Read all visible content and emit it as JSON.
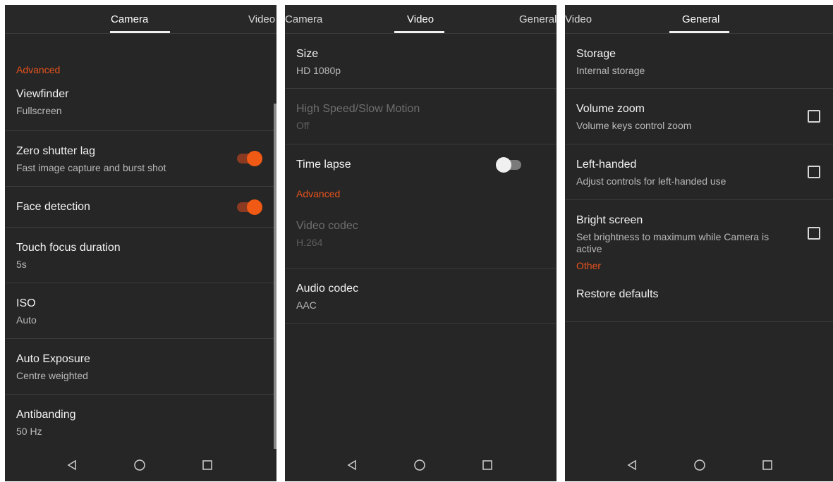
{
  "panels": {
    "camera": {
      "tabs": {
        "active": "Camera",
        "right": "Video"
      },
      "section_advanced": "Advanced",
      "items": [
        {
          "title": "Viewfinder",
          "subtitle": "Fullscreen"
        },
        {
          "title": "Zero shutter lag",
          "subtitle": "Fast image capture and burst shot",
          "toggle": "on"
        },
        {
          "title": "Face detection",
          "toggle": "on"
        },
        {
          "title": "Touch focus duration",
          "subtitle": "5s"
        },
        {
          "title": "ISO",
          "subtitle": "Auto"
        },
        {
          "title": "Auto Exposure",
          "subtitle": "Centre weighted"
        },
        {
          "title": "Antibanding",
          "subtitle": "50 Hz"
        }
      ]
    },
    "video": {
      "tabs": {
        "left": "Camera",
        "active": "Video",
        "right": "General"
      },
      "section_advanced": "Advanced",
      "items": [
        {
          "title": "Size",
          "subtitle": "HD 1080p"
        },
        {
          "title": "High Speed/Slow Motion",
          "subtitle": "Off",
          "disabled": true
        },
        {
          "title": "Time lapse",
          "toggle": "off"
        },
        {
          "title": "Video codec",
          "subtitle": "H.264",
          "disabled": true
        },
        {
          "title": "Audio codec",
          "subtitle": "AAC"
        }
      ]
    },
    "general": {
      "tabs": {
        "left": "Video",
        "active": "General"
      },
      "section_other": "Other",
      "items": [
        {
          "title": "Storage",
          "subtitle": "Internal storage"
        },
        {
          "title": "Volume zoom",
          "subtitle": "Volume keys control zoom",
          "checked": false
        },
        {
          "title": "Left-handed",
          "subtitle": "Adjust controls for left-handed use",
          "checked": false
        },
        {
          "title": "Bright screen",
          "subtitle_line1": "Set brightness to maximum while Camera is",
          "subtitle_line2": "active",
          "checked": false
        },
        {
          "title": "Restore defaults"
        }
      ]
    }
  },
  "navbar_icons": [
    "back-icon",
    "home-icon",
    "recents-icon"
  ],
  "colors": {
    "accent": "#f05a14",
    "section_header": "#e8531d",
    "background": "#262626"
  }
}
